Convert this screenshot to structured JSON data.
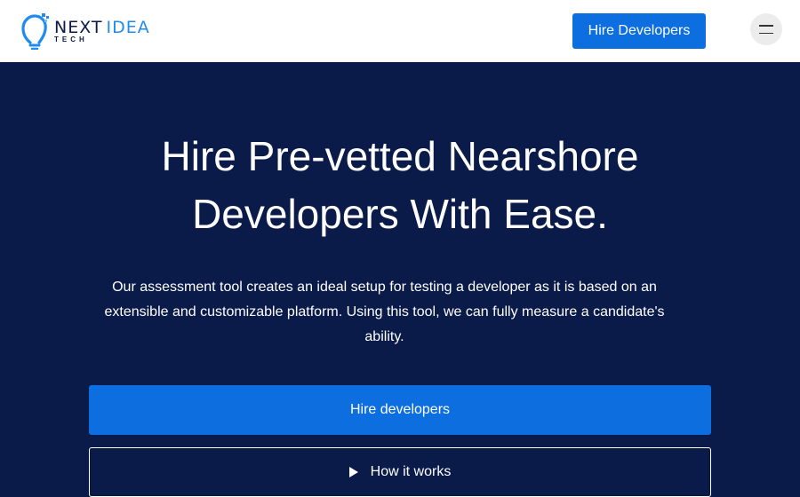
{
  "header": {
    "logo": {
      "word_next": "NEXT",
      "word_idea": "IDEA",
      "word_tech": "TECH",
      "icon": "lightbulb-icon"
    },
    "cta_label": "Hire Developers",
    "menu_icon": "hamburger-menu-icon"
  },
  "hero": {
    "title": "Hire Pre-vetted Nearshore\nDevelopers With Ease.",
    "description": "Our assessment tool creates an ideal setup for testing a developer as it is based on an extensible and customizable platform. Using this tool, we can fully measure a candidate's ability.",
    "primary_button": "Hire developers",
    "secondary_button": "How it works",
    "secondary_icon": "play-icon"
  },
  "colors": {
    "navy": "#0a1b4a",
    "brand_blue": "#0d6ee0",
    "logo_blue": "#1f8bf0"
  }
}
